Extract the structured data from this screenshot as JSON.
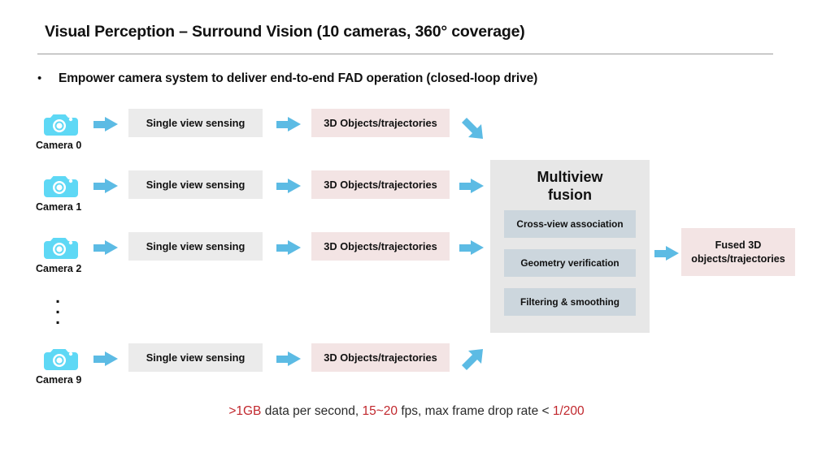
{
  "header": {
    "title": "Visual Perception – Surround Vision (10 cameras, 360° coverage)",
    "bullet_marker": "•",
    "bullet_text": "Empower camera system to deliver end-to-end FAD operation (closed-loop drive)"
  },
  "colors": {
    "camera_icon": "#5ed8f5",
    "arrow": "#5cbbe4",
    "process_box": "#ebebeb",
    "output_box": "#f3e4e4",
    "fusion_panel": "#e7e7e7",
    "fusion_sub_box": "#ccd6dd",
    "highlight_text": "#c1272d",
    "rule": "#9b9b9b"
  },
  "pipeline": {
    "process_label": "Single view sensing",
    "output_label": "3D Objects/trajectories",
    "rows": [
      {
        "camera_label": "Camera 0",
        "process_label": "Single view sensing",
        "output_label": "3D Objects/trajectories",
        "tail_arrow": "arrow-down-right-icon"
      },
      {
        "camera_label": "Camera 1",
        "process_label": "Single view sensing",
        "output_label": "3D Objects/trajectories",
        "tail_arrow": "arrow-right-icon"
      },
      {
        "camera_label": "Camera 2",
        "process_label": "Single view sensing",
        "output_label": "3D Objects/trajectories",
        "tail_arrow": "arrow-right-icon"
      },
      {
        "camera_label": "Camera 9",
        "process_label": "Single view sensing",
        "output_label": "3D Objects/trajectories",
        "tail_arrow": "arrow-up-right-icon"
      }
    ],
    "ellipsis": "⋮"
  },
  "fusion": {
    "title_line1": "Multiview",
    "title_line2": "fusion",
    "stages": [
      "Cross-view association",
      "Geometry verification",
      "Filtering & smoothing"
    ]
  },
  "fused_output": {
    "line1": "Fused 3D",
    "line2": "objects/trajectories"
  },
  "footer": {
    "part1": ">1GB",
    "part2": " data per second, ",
    "part3": "15~20",
    "part4": " fps, max frame drop rate < ",
    "part5": "1/200"
  }
}
